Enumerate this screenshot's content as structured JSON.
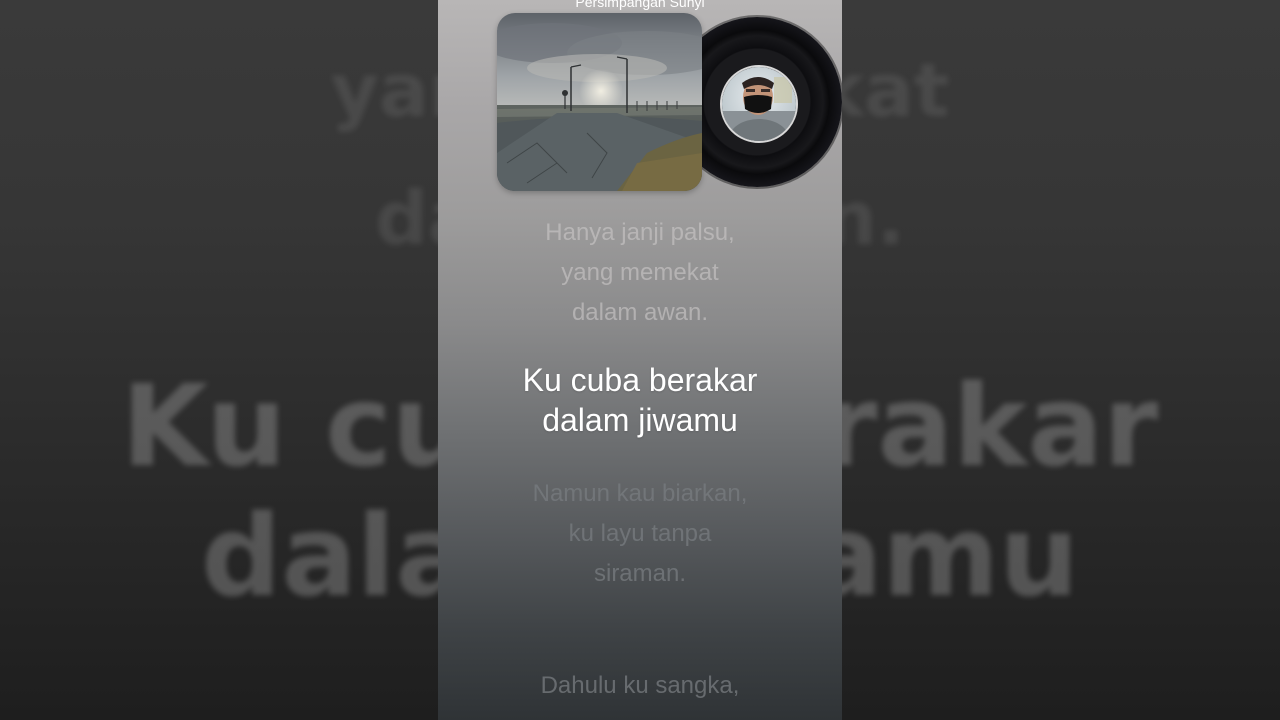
{
  "song": {
    "title": "Persimpangan Sunyi"
  },
  "album_art": {
    "icon": "foggy-crossroad-artwork"
  },
  "vinyl": {
    "icon": "vinyl-record-icon",
    "label_icon": "artist-avatar"
  },
  "background_echo": {
    "line1": "Ku cuba berakar",
    "line2": "dalam jiwamu",
    "faint1": "yang memekat",
    "faint2": "dalam awan."
  },
  "lyrics": {
    "previous": [
      "Hanya janji palsu,",
      "yang memekat",
      "dalam awan."
    ],
    "current": [
      "Ku cuba berakar",
      "dalam jiwamu"
    ],
    "next": [
      "Namun kau biarkan,",
      "ku layu tanpa",
      "siraman."
    ],
    "upcoming": [
      "Dahulu ku sangka,"
    ]
  },
  "colors": {
    "current_lyric": "#ffffff",
    "panel_top": "#b8b6b6",
    "panel_bottom": "#2f3336"
  }
}
